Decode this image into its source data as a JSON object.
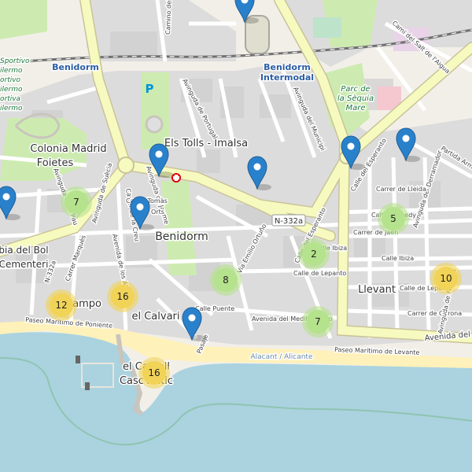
{
  "map": {
    "labels": {
      "benidorm_station": "Benidorm",
      "intermodal_1": "Benidorm",
      "intermodal_2": "Intermodal",
      "parc_1": "Parc de",
      "parc_2": "la Sèquia",
      "parc_3": "Mare",
      "colonia_1": "Colonia Madrid",
      "colonia_2": "Foietes",
      "els_tolls": "Els Tolls - Imalsa",
      "benidorm_center": "Benidorm",
      "bol_1": "bia del Bol",
      "bol_2": "Cementeri",
      "campo": "Campo",
      "calvari": "el Calvari",
      "castell_1": "el Castell",
      "castell_2": "Casc Antic",
      "llevant": "Llevant",
      "road_sign": "N-332a",
      "sportivo": [
        "Sportivo",
        "ilermo",
        "ortivo",
        "ilermo",
        "ortiva",
        "ilermo"
      ],
      "alacant": "Alacant / Alicante",
      "parking": "P"
    },
    "streets": {
      "camino_del": "Camino del",
      "cami_salt": "Camí del Salt de l'Aigua",
      "avenida_portugal": "Avinguda de Portugal",
      "avenida_municipi": "Avinguda del Municipi",
      "partida_armanello": "Partida Armanello",
      "calle_esperanto_1": "Calle del Esperanto",
      "calle_esperanto_2": "Calle del Esperanto",
      "avenida_derramador": "Avinguda del Derramador",
      "carrer_lleida": "Carrer de Lleida",
      "calle_kennedy": "Calle Kennedy",
      "carrer_jaen": "Carrer de Jaén",
      "calle_ibiza_1": "Calle Ibiza",
      "calle_ibiza_2": "Calle Ibiza",
      "calle_lepanto_1": "Calle de Lepanto",
      "calle_lepanto_2": "Calle de Lepanto",
      "carrer_girona": "Carrer de Gerona",
      "avenida_filipinas": "Avinguda de Filipinas",
      "avenida_mediterraneo_1": "Avenida del Mediterráneo",
      "avenida_mediterraneo_2": "Avenida del Mediterráneo",
      "via_emilio": "Via Emilio Ortuño",
      "calle_puente": "Calle Puente",
      "pasaje": "Pasaje",
      "paseo_levante": "Paseo Marítimo de Levante",
      "paseo_poniente": "Paseo Marítimo de Poniente",
      "carrer_marqui": "Carrer Marquès",
      "avenida_alps": "Avenida de los Alpes",
      "avinguda_jaume": "Avinguda de Jaume",
      "carrer_arq": "Carrer de la Creu",
      "n332a_side": "N-332a",
      "de_la_pau": "Avinguda de la Pau",
      "avinguda_suecia": "Avinguda de Suècia",
      "carrer_tomas": "Carrer Tomàs",
      "ortega": "Orts"
    },
    "clusters": [
      {
        "id": "c1",
        "count": "7"
      },
      {
        "id": "c2",
        "count": "5"
      },
      {
        "id": "c3",
        "count": "2"
      },
      {
        "id": "c4",
        "count": "8"
      },
      {
        "id": "c5",
        "count": "10"
      },
      {
        "id": "c6",
        "count": "12"
      },
      {
        "id": "c7",
        "count": "16"
      },
      {
        "id": "c8",
        "count": "7"
      },
      {
        "id": "c9",
        "count": "16"
      }
    ],
    "colors": {
      "sea": "#aad3df",
      "land": "#f2efe9",
      "residential": "#e0dfdf",
      "park": "#c8facc",
      "primary_road": "#f7fabf",
      "road_casing": "#c9c39a",
      "beach": "#fff1ba",
      "cluster_small": "#b5e28c",
      "cluster_medium": "#f1d357",
      "marker": "#2a81cb",
      "hospital": "#da0000"
    }
  }
}
